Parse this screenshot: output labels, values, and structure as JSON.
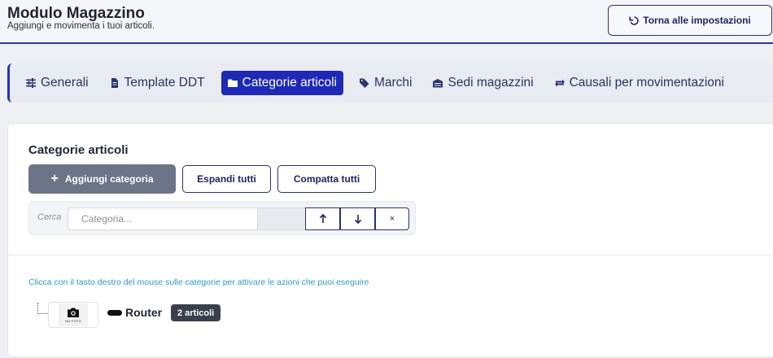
{
  "header": {
    "title": "Modulo Magazzino",
    "subtitle": "Aggiungi e movimenta i tuoi articoli.",
    "back_label": "Torna alle impostazioni"
  },
  "tabs": [
    {
      "label": "Generali",
      "icon": "sliders-icon",
      "active": false
    },
    {
      "label": "Template DDT",
      "icon": "document-icon",
      "active": false
    },
    {
      "label": "Categorie articoli",
      "icon": "folder-icon",
      "active": true
    },
    {
      "label": "Marchi",
      "icon": "tag-icon",
      "active": false
    },
    {
      "label": "Sedi magazzini",
      "icon": "warehouse-icon",
      "active": false
    },
    {
      "label": "Causali per movimentazioni",
      "icon": "exchange-icon",
      "active": false
    }
  ],
  "section": {
    "title": "Categorie articoli",
    "add_label": "Aggiungi categoria",
    "expand_label": "Espandi tutti",
    "collapse_label": "Compatta tutti"
  },
  "search": {
    "label": "Cerca",
    "placeholder": "Categoria...",
    "value": "",
    "clear_label": "×"
  },
  "hint": "Clicca con il tasto destro del mouse sulle categorie per attivare le azioni che puoi eseguire",
  "tree": [
    {
      "name": "Router",
      "badge": "2 articoli",
      "thumb_text": "NO FOTO"
    }
  ],
  "colors": {
    "accent": "#1e29b8",
    "primary_border": "#2b3070",
    "hint": "#2a9bc7",
    "add_button": "#6c7487",
    "badge": "#3a3f4b"
  }
}
